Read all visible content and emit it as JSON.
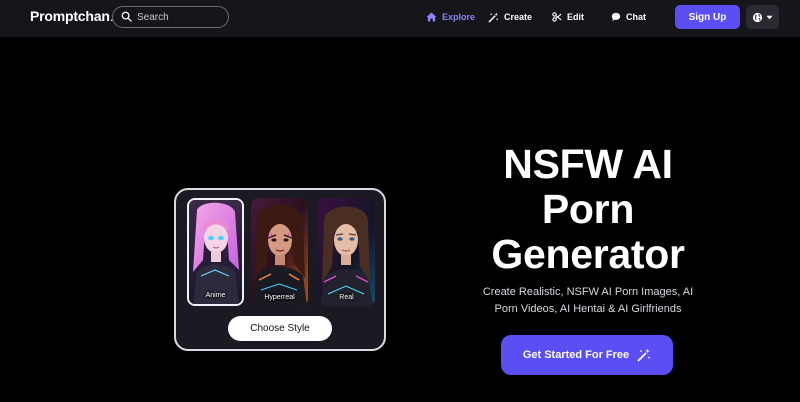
{
  "header": {
    "logo": {
      "brand": "Promptchan",
      "domain": ".ai"
    },
    "search": {
      "placeholder": "Search"
    },
    "nav": [
      {
        "label": "Explore",
        "icon": "home-icon",
        "active": true
      },
      {
        "label": "Create",
        "icon": "magic-wand-icon",
        "active": false
      },
      {
        "label": "Edit",
        "icon": "scissors-icon",
        "active": false
      },
      {
        "label": "Chat",
        "icon": "chat-bubble-icon",
        "active": false
      }
    ],
    "signup_label": "Sign Up",
    "language_icon": "globe-icon"
  },
  "style_picker": {
    "styles": [
      {
        "label": "Anime",
        "selected": true
      },
      {
        "label": "Hyperreal",
        "selected": false
      },
      {
        "label": "Real",
        "selected": false
      }
    ],
    "choose_label": "Choose Style"
  },
  "hero": {
    "title": "NSFW AI Porn Generator",
    "subtitle": "Create Realistic, NSFW AI Porn Images, AI Porn Videos, AI Hentai & AI Girlfriends",
    "cta_label": "Get Started For Free"
  },
  "colors": {
    "accent": "#5b4ef2",
    "active_nav": "#8b82ff",
    "background": "#000000",
    "header_bg": "#15151a"
  }
}
